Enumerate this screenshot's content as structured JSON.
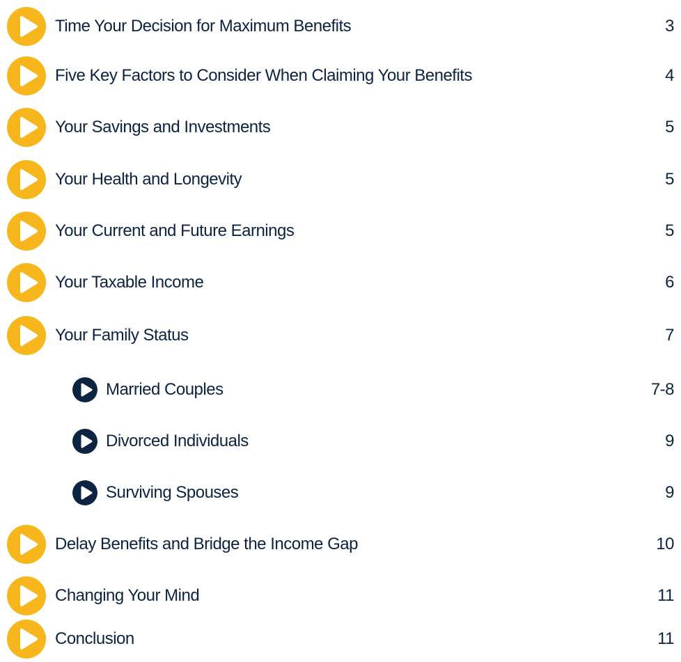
{
  "colors": {
    "main_icon": "#f7b61b",
    "sub_icon": "#0c2342",
    "text": "#0c2342",
    "arrow_on_main": "#ffffff",
    "arrow_on_sub": "#ffffff"
  },
  "icons": {
    "main": "play-icon",
    "sub": "play-icon"
  },
  "toc": {
    "items": [
      {
        "label": "Time Your Decision for Maximum Benefits",
        "page": "3"
      },
      {
        "label": "Five Key Factors to Consider When Claiming Your Benefits",
        "page": "4"
      },
      {
        "label": "Your Savings and Investments",
        "page": "5"
      },
      {
        "label": "Your Health and Longevity",
        "page": "5"
      },
      {
        "label": "Your Current and Future Earnings",
        "page": "5"
      },
      {
        "label": "Your Taxable Income",
        "page": "6"
      },
      {
        "label": "Your Family Status",
        "page": "7"
      },
      {
        "label": "Married Couples",
        "page": "7-8"
      },
      {
        "label": "Divorced Individuals",
        "page": "9"
      },
      {
        "label": "Surviving Spouses",
        "page": "9"
      },
      {
        "label": "Delay Benefits and Bridge the Income Gap",
        "page": "10"
      },
      {
        "label": "Changing Your Mind",
        "page": "11"
      },
      {
        "label": "Conclusion",
        "page": "11"
      }
    ]
  }
}
